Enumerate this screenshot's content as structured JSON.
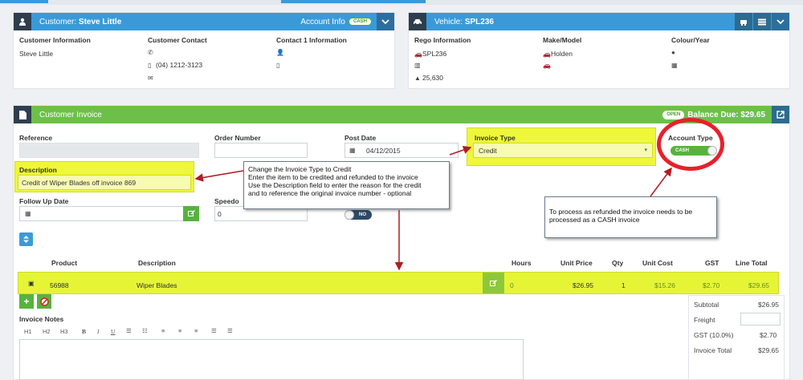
{
  "customer": {
    "prefix": "Customer:",
    "name": "Steve Little",
    "account_info": "Account Info",
    "account_badge": "CASH",
    "col1_label": "Customer Information",
    "col1_value": "Steve Little",
    "col2_label": "Customer Contact",
    "phone": "(04) 1212-3123",
    "col3_label": "Contact 1 Information"
  },
  "vehicle": {
    "prefix": "Vehicle:",
    "rego": "SPL236",
    "col1_label": "Rego Information",
    "rego_value": "SPL236",
    "odometer": "25,630",
    "col2_label": "Make/Model",
    "make": "Holden",
    "col3_label": "Colour/Year"
  },
  "invoice": {
    "title": "Customer Invoice",
    "status": "OPEN",
    "balance": "Balance Due: $29.65",
    "reference_label": "Reference",
    "order_label": "Order Number",
    "post_date_label": "Post Date",
    "post_date": "04/12/2015",
    "invoice_type_label": "Invoice Type",
    "invoice_type": "Credit",
    "account_type_label": "Account Type",
    "account_type": "CASH",
    "description_label": "Description",
    "description": "Credit of Wiper Blades off invoice 869",
    "followup_label": "Follow Up Date",
    "speedo_label": "Speedo",
    "speedo": "0",
    "toggle_no": "NO"
  },
  "table": {
    "headers": {
      "product": "Product",
      "description": "Description",
      "hours": "Hours",
      "unit_price": "Unit Price",
      "qty": "Qty",
      "unit_cost": "Unit Cost",
      "gst": "GST",
      "line_total": "Line Total"
    },
    "rows": [
      {
        "product": "56988",
        "description": "Wiper Blades",
        "hours": "0",
        "unit_price": "$26.95",
        "qty": "1",
        "unit_cost": "$15.26",
        "gst": "$2.70",
        "line_total": "$29.65"
      }
    ]
  },
  "totals": {
    "subtotal_label": "Subtotal",
    "subtotal": "$26.95",
    "freight_label": "Freight",
    "gst_label": "GST (10.0%)",
    "gst": "$2.70",
    "total_label": "Invoice Total",
    "total": "$29.65"
  },
  "notes": {
    "label": "Invoice Notes",
    "toolbar": [
      "H1",
      "H2",
      "H3",
      "B",
      "I",
      "U"
    ]
  },
  "callouts": {
    "main": [
      "Change the Invoice Type to Credit",
      "Enter the item to be credited and refunded to the invoice",
      "Use the Description field to enter the reason for the credit",
      "and to reference the original invoice number - optional"
    ],
    "cash": [
      "To process as refunded the invoice needs to be",
      "processed as a CASH invoice"
    ]
  },
  "colors": {
    "accent_blue": "#3a9ad9",
    "accent_green": "#6cc04a",
    "highlight": "#eef73a",
    "annotation_red": "#e8202a"
  }
}
